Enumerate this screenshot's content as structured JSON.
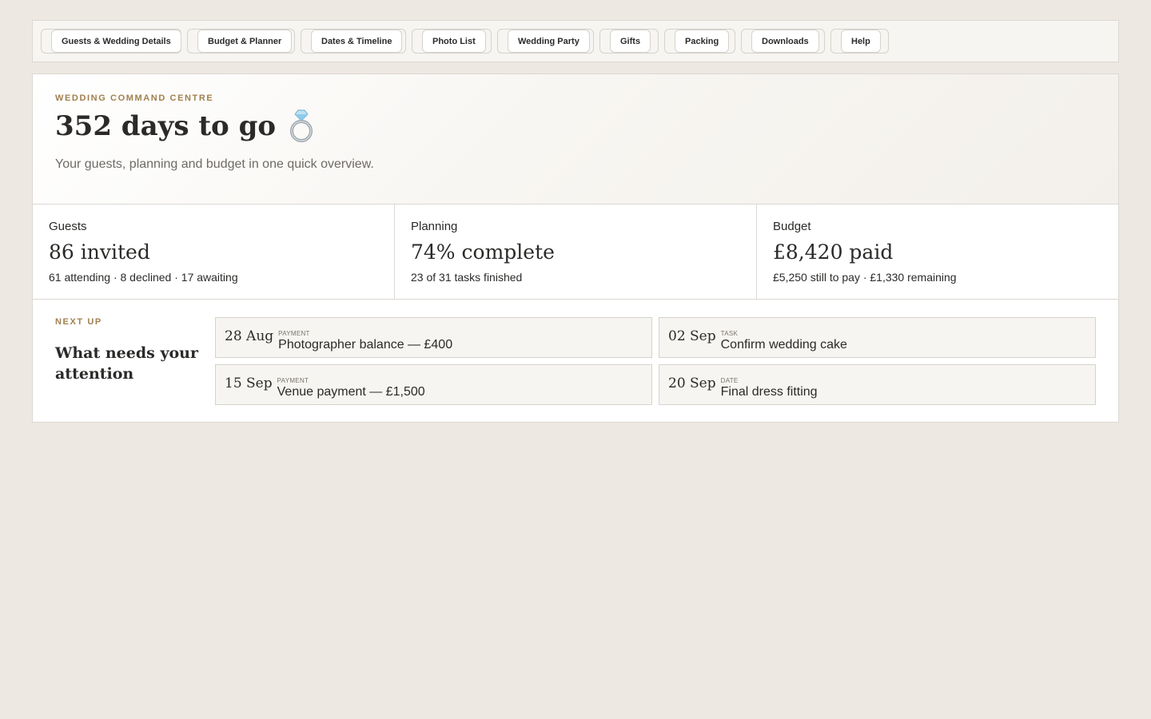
{
  "nav": {
    "tabs": [
      {
        "label": "Guests & Wedding Details"
      },
      {
        "label": "Budget & Planner"
      },
      {
        "label": "Dates & Timeline"
      },
      {
        "label": "Photo List"
      },
      {
        "label": "Wedding Party"
      },
      {
        "label": "Gifts"
      },
      {
        "label": "Packing"
      },
      {
        "label": "Downloads"
      },
      {
        "label": "Help"
      }
    ]
  },
  "hero": {
    "eyebrow": "WEDDING COMMAND CENTRE",
    "title": "352 days to go",
    "icon": "ring-icon",
    "subtitle": "Your guests, planning and budget in one quick overview."
  },
  "stats": {
    "guests": {
      "label": "Guests",
      "value": "86 invited",
      "detail": "61 attending · 8 declined · 17 awaiting"
    },
    "planning": {
      "label": "Planning",
      "value": "74% complete",
      "detail": "23 of 31 tasks finished"
    },
    "budget": {
      "label": "Budget",
      "value": "£8,420 paid",
      "detail": "£5,250 still to pay · £1,330 remaining"
    }
  },
  "nextup": {
    "eyebrow": "NEXT UP",
    "heading": "What needs your attention",
    "events": [
      {
        "date": "28 Aug",
        "kind": "PAYMENT",
        "title": "Photographer balance — £400"
      },
      {
        "date": "02 Sep",
        "kind": "TASK",
        "title": "Confirm wedding cake"
      },
      {
        "date": "15 Sep",
        "kind": "PAYMENT",
        "title": "Venue payment — £1,500"
      },
      {
        "date": "20 Sep",
        "kind": "DATE",
        "title": "Final dress fitting"
      }
    ]
  },
  "colors": {
    "background": "#ede8e2",
    "accent": "#a0804e",
    "border": "#dcd8d2",
    "text": "#2b2a28"
  }
}
